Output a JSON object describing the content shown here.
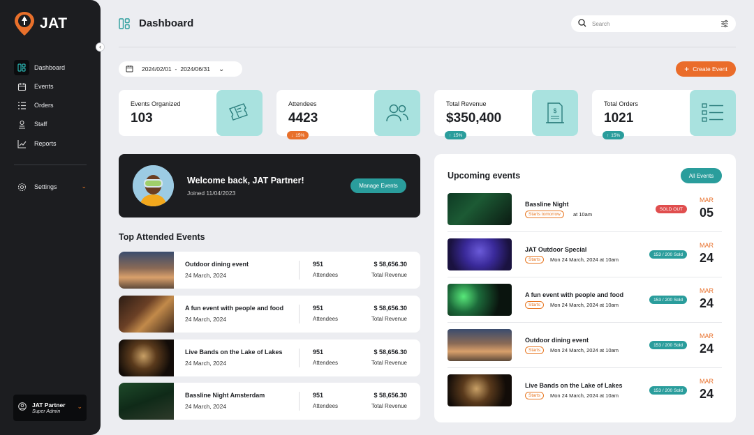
{
  "brand": {
    "name": "JAT"
  },
  "sidebar": {
    "items": [
      {
        "label": "Dashboard"
      },
      {
        "label": "Events"
      },
      {
        "label": "Orders"
      },
      {
        "label": "Staff"
      },
      {
        "label": "Reports"
      }
    ],
    "settings_label": "Settings",
    "user": {
      "name": "JAT Partner",
      "role": "Super Admin"
    }
  },
  "header": {
    "title": "Dashboard",
    "search_placeholder": "Search"
  },
  "toolbar": {
    "date_from": "2024/02/01",
    "date_sep": "-",
    "date_to": "2024/06/31",
    "create_label": "Create Event"
  },
  "stats": [
    {
      "label": "Events Organized",
      "value": "103"
    },
    {
      "label": "Attendees",
      "value": "4423",
      "change": "15%",
      "direction": "down",
      "color": "#e8702b"
    },
    {
      "label": "Total Revenue",
      "value": "$350,400",
      "change": "15%",
      "direction": "up",
      "color": "#2a9d9c"
    },
    {
      "label": "Total Orders",
      "value": "1021",
      "change": "15%",
      "direction": "up",
      "color": "#2a9d9c"
    }
  ],
  "welcome": {
    "title": "Welcome back, JAT Partner!",
    "joined": "Joined 11/04/2023",
    "button": "Manage Events"
  },
  "top_events": {
    "title": "Top Attended Events",
    "items": [
      {
        "name": "Outdoor dining event",
        "date": "24 March, 2024",
        "attendees": "951",
        "attendees_label": "Attendees",
        "revenue": "$ 58,656.30",
        "revenue_label": "Total Revenue"
      },
      {
        "name": "A fun event with people and food",
        "date": "24 March, 2024",
        "attendees": "951",
        "attendees_label": "Attendees",
        "revenue": "$ 58,656.30",
        "revenue_label": "Total Revenue"
      },
      {
        "name": "Live Bands on the Lake of Lakes",
        "date": "24 March, 2024",
        "attendees": "951",
        "attendees_label": "Attendees",
        "revenue": "$ 58,656.30",
        "revenue_label": "Total Revenue"
      },
      {
        "name": "Bassline Night Amsterdam",
        "date": "24 March, 2024",
        "attendees": "951",
        "attendees_label": "Attendees",
        "revenue": "$ 58,656.30",
        "revenue_label": "Total Revenue"
      }
    ]
  },
  "upcoming": {
    "title": "Upcoming events",
    "all_label": "All Events",
    "items": [
      {
        "name": "Bassline Night",
        "pill": "Starts tomorrow",
        "when": "at 10am",
        "tag": "SOLD OUT",
        "tag_color": "#e04e4e",
        "month": "MAR",
        "day": "05"
      },
      {
        "name": "JAT Outdoor Special",
        "pill": "Starts",
        "when": "Mon 24 March, 2024 at 10am",
        "tag": "153 / 200 Sold",
        "tag_color": "#2a9d9c",
        "month": "MAR",
        "day": "24"
      },
      {
        "name": "A fun event with people and food",
        "pill": "Starts",
        "when": "Mon 24 March, 2024 at 10am",
        "tag": "153 / 200 Sold",
        "tag_color": "#2a9d9c",
        "month": "MAR",
        "day": "24"
      },
      {
        "name": "Outdoor dining event",
        "pill": "Starts",
        "when": "Mon 24 March, 2024 at 10am",
        "tag": "153 / 200 Sold",
        "tag_color": "#2a9d9c",
        "month": "MAR",
        "day": "24"
      },
      {
        "name": "Live Bands on the Lake of Lakes",
        "pill": "Starts",
        "when": "Mon 24 March, 2024 at 10am",
        "tag": "153 / 200 Sold",
        "tag_color": "#2a9d9c",
        "month": "MAR",
        "day": "24"
      }
    ]
  },
  "colors": {
    "accent": "#e8702b",
    "teal": "#2a9d9c",
    "tile": "#a9e2df",
    "dark": "#1c1d20"
  }
}
